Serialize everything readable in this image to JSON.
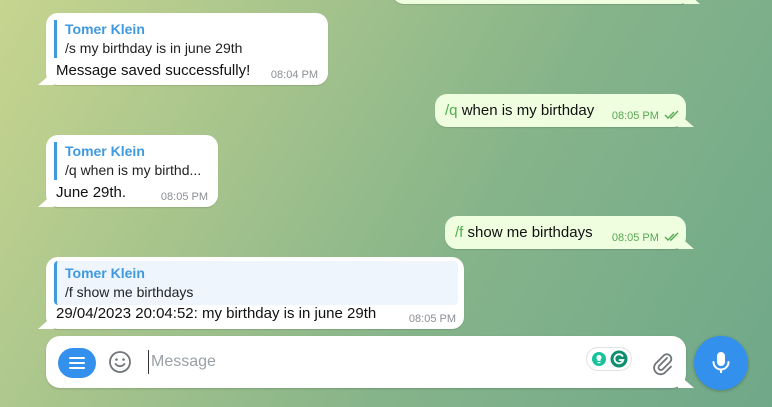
{
  "messages": [
    {
      "sender": "Tomer Klein",
      "quote": "/s my birthday is in june 29th",
      "text": "Message saved successfully!",
      "time": "08:04 PM"
    },
    {
      "command": "/q",
      "text": "when is my birthday",
      "time": "08:05 PM"
    },
    {
      "sender": "Tomer Klein",
      "quote": "/q when is my birthd...",
      "text": "June 29th.",
      "time": "08:05 PM"
    },
    {
      "command": "/f",
      "text": "show me birthdays",
      "time": "08:05 PM"
    },
    {
      "sender": "Tomer Klein",
      "quote": "/f show me birthdays",
      "text": "29/04/2023 20:04:52: my birthday is in june 29th",
      "time": "08:05 PM"
    }
  ],
  "composer": {
    "placeholder": "Message"
  },
  "icons": {
    "menu": "menu-icon",
    "emoji": "smile-icon",
    "grammarly": "grammarly-icon",
    "attach": "paperclip-icon",
    "mic": "microphone-icon",
    "read": "double-check-icon"
  },
  "colors": {
    "accent": "#3390ec",
    "outgoing_bubble": "#eefedf",
    "command": "#4fae4e",
    "sender_name": "#3f9ae0"
  }
}
